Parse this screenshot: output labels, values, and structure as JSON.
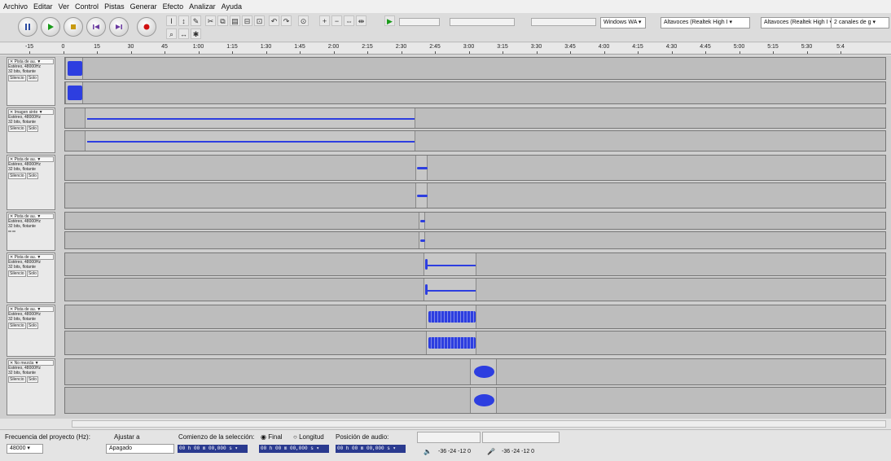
{
  "menu": [
    "Archivo",
    "Editar",
    "Ver",
    "Control",
    "Pistas",
    "Generar",
    "Efecto",
    "Analizar",
    "Ayuda"
  ],
  "transport": [
    {
      "name": "pause-button",
      "icon": "pause-icon"
    },
    {
      "name": "play-button",
      "icon": "play-icon"
    },
    {
      "name": "stop-button",
      "icon": "stop-icon"
    },
    {
      "name": "skip-start-button",
      "icon": "skip-start-icon"
    },
    {
      "name": "skip-end-button",
      "icon": "skip-end-icon"
    },
    {
      "name": "record-button",
      "icon": "record-icon"
    }
  ],
  "colors": {
    "accent": "#2d3ee0",
    "record": "#d01010",
    "play": "#1a9a1a"
  },
  "devices": {
    "host": "Windows WA ▾",
    "output": "Altavoces (Realtek High I ▾",
    "input": "Altavoces (Realtek High I ▾",
    "channels": "2 canales de g ▾"
  },
  "ruler_labels": [
    "-15",
    "0",
    "15",
    "30",
    "45",
    "1:00",
    "1:15",
    "1:30",
    "1:45",
    "2:00",
    "2:15",
    "2:30",
    "2:45",
    "3:00",
    "3:15",
    "3:30",
    "3:45",
    "4:00",
    "4:15",
    "4:30",
    "4:45",
    "5:00",
    "5:15",
    "5:30",
    "5:4"
  ],
  "tracks": [
    {
      "name": "Pista de au.",
      "info": [
        "Estéreo, 48000Hz",
        "32 bits, flotante"
      ],
      "mute": "Silencio",
      "solo": "Solo"
    },
    {
      "name": "Imagen sinte",
      "info": [
        "Estéreo, 48000Hz",
        "32 bits, flotante"
      ],
      "mute": "Silencio",
      "solo": "Solo"
    },
    {
      "name": "Pista de au.",
      "info": [
        "Estéreo, 48000Hz",
        "32 bits, flotante"
      ],
      "mute": "Silencio",
      "solo": "Solo"
    },
    {
      "name": "Pista de au.",
      "info": [
        "Estéreo, 48000Hz",
        "32 bits, flotante"
      ],
      "mute": "",
      "solo": ""
    },
    {
      "name": "Pista de au.",
      "info": [
        "Estéreo, 48000Hz",
        "32 bits, flotante"
      ],
      "mute": "Silencio",
      "solo": "Solo"
    },
    {
      "name": "Pista de au.",
      "info": [
        "Estéreo, 48000Hz",
        "32 bits, flotante"
      ],
      "mute": "Silencio",
      "solo": "Solo"
    },
    {
      "name": "No mezcla",
      "info": [
        "Estéreo, 48000Hz",
        "32 bits, flotante"
      ],
      "mute": "Silencio",
      "solo": "Solo"
    }
  ],
  "status": {
    "rate_label": "Frecuencia del proyecto (Hz):",
    "rate_value": "48000 ▾",
    "snap_label": "Ajustar a",
    "snap_value": "Apagado",
    "selstart_label": "Comienzo de la selección:",
    "end_option": "Final",
    "length_option": "Longitud",
    "audiopos_label": "Posición de audio:",
    "time1": "00 h 00 m 00,000 s ▾",
    "time2": "00 h 00 m 00,000 s ▾",
    "time3": "00 h 00 m 00,000 s ▾",
    "meter_scale": "-36  -24  -12  0",
    "meter_scale2": "-36  -24  -12  0"
  }
}
